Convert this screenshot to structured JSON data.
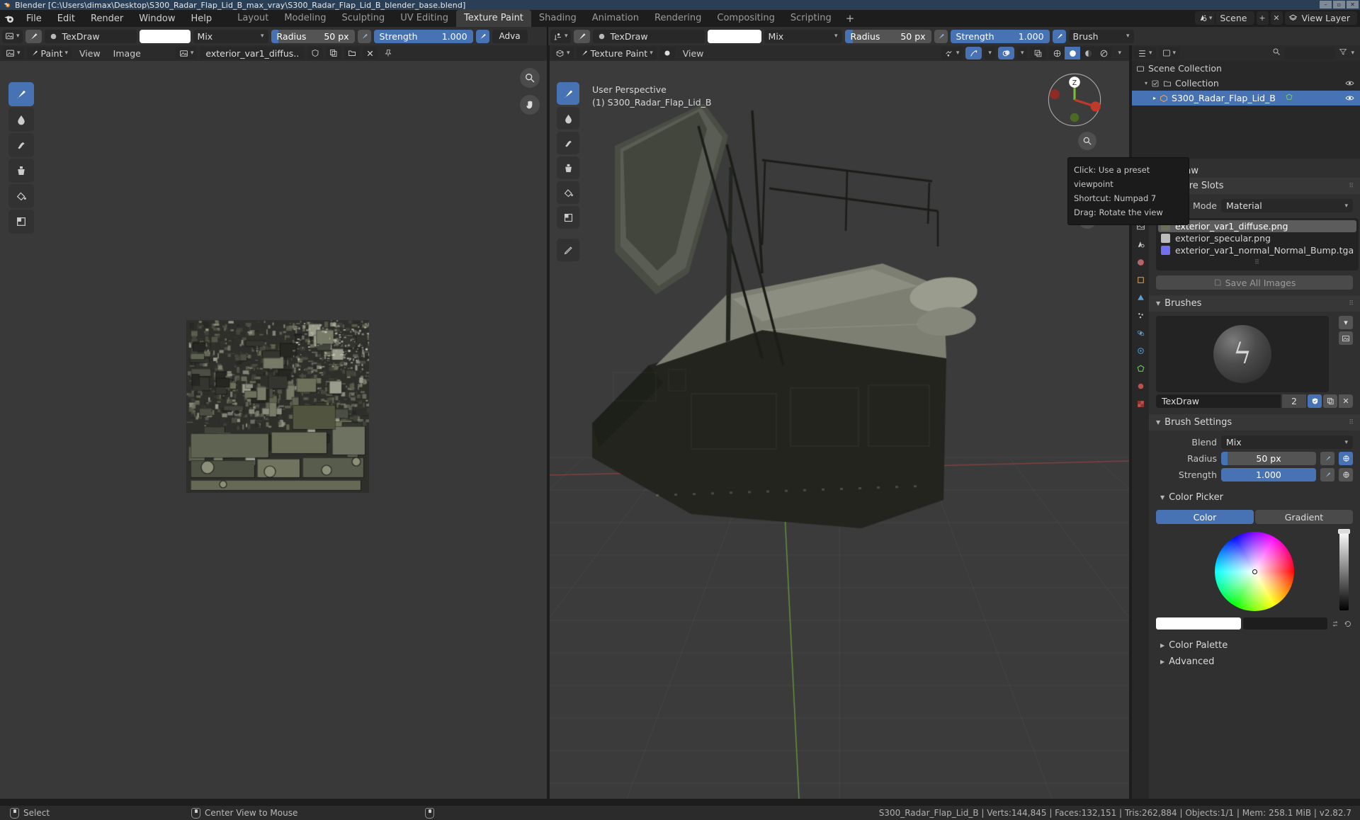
{
  "titlebar": {
    "text": "Blender [C:\\Users\\dimax\\Desktop\\S300_Radar_Flap_Lid_B_max_vray\\S300_Radar_Flap_Lid_B_blender_base.blend]",
    "minimize": "–",
    "maximize": "▫",
    "close": "✕"
  },
  "menu": {
    "items": [
      "File",
      "Edit",
      "Render",
      "Window",
      "Help"
    ]
  },
  "workspace_tabs": [
    {
      "label": "Layout",
      "active": false
    },
    {
      "label": "Modeling",
      "active": false
    },
    {
      "label": "Sculpting",
      "active": false
    },
    {
      "label": "UV Editing",
      "active": false
    },
    {
      "label": "Texture Paint",
      "active": true
    },
    {
      "label": "Shading",
      "active": false
    },
    {
      "label": "Animation",
      "active": false
    },
    {
      "label": "Rendering",
      "active": false
    },
    {
      "label": "Compositing",
      "active": false
    },
    {
      "label": "Scripting",
      "active": false
    }
  ],
  "workspace_add": "+",
  "topright": {
    "scene_name": "Scene",
    "viewlayer_name": "View Layer",
    "new_scene": "+",
    "unlink_scene": "✕",
    "new_layer": "+",
    "remove_layer": "✕"
  },
  "toolsettings_left": {
    "brush_name": "TexDraw",
    "blend": "Mix",
    "radius_label": "Radius",
    "radius_value": "50 px",
    "strength_label": "Strength",
    "strength_value": "1.000",
    "advanced_label": "Adva"
  },
  "toolsettings_right": {
    "brush_name": "TexDraw",
    "blend": "Mix",
    "radius_label": "Radius",
    "radius_value": "50 px",
    "strength_label": "Strength",
    "strength_value": "1.000",
    "brush_label": "Brush"
  },
  "image_editor": {
    "mode": "Paint",
    "menus": [
      "View",
      "Image"
    ],
    "image_name": "exterior_var1_diffus.."
  },
  "viewport": {
    "mode": "Texture Paint",
    "menus": [
      "View"
    ],
    "perspective_label": "User Perspective",
    "object_label": "(1) S300_Radar_Flap_Lid_B",
    "gizmo_axis_z": "Z"
  },
  "tooltip": {
    "line1": "Click: Use a preset viewpoint",
    "line2": "Shortcut: Numpad 7",
    "line3": "Drag: Rotate the view"
  },
  "outliner": {
    "header_label": "Scene Collection",
    "rows": [
      {
        "label": "Scene Collection",
        "indent": 0,
        "selected": false,
        "type": "scene"
      },
      {
        "label": "Collection",
        "indent": 1,
        "selected": false,
        "type": "collection"
      },
      {
        "label": "S300_Radar_Flap_Lid_B",
        "indent": 2,
        "selected": true,
        "type": "object"
      }
    ]
  },
  "properties": {
    "active_tool_header": "Draw",
    "texture_slots": {
      "title": "Texture Slots",
      "mode_label": "Mode",
      "mode_value": "Material",
      "add_button": "+",
      "slots": [
        {
          "name": "exterior_var1_diffuse.png",
          "selected": true,
          "swatch": "#6b6f5a"
        },
        {
          "name": "exterior_specular.png",
          "selected": false,
          "swatch": "#b8b8b8"
        },
        {
          "name": "exterior_var1_normal_Normal_Bump.tga",
          "selected": false,
          "swatch": "#7070f0"
        }
      ],
      "save_all_images": "Save All Images"
    },
    "brushes": {
      "title": "Brushes",
      "brush_name": "TexDraw",
      "users_count": "2",
      "fake_user_icon": "shield-check-icon",
      "duplicate_icon": "copy-icon",
      "delete_icon": "✕"
    },
    "brush_settings": {
      "title": "Brush Settings",
      "blend_label": "Blend",
      "blend_value": "Mix",
      "radius_label": "Radius",
      "radius_value": "50 px",
      "strength_label": "Strength",
      "strength_value": "1.000"
    },
    "color_picker": {
      "title": "Color Picker",
      "tabs": [
        {
          "label": "Color",
          "active": true
        },
        {
          "label": "Gradient",
          "active": false
        }
      ],
      "primary_color": "#ffffff",
      "secondary_color": "#000000"
    },
    "color_palette_title": "Color Palette",
    "advanced_title": "Advanced"
  },
  "statusbar": {
    "left_items": [
      {
        "icon": "mouse-left-icon",
        "label": "Select"
      },
      {
        "icon": "mouse-middle-icon",
        "label": "Center View to Mouse"
      },
      {
        "icon": "mouse-right-icon",
        "label": ""
      }
    ],
    "right_text": "S300_Radar_Flap_Lid_B | Verts:144,845 | Faces:132,151 | Tris:262,884 | Objects:1/1 | Mem: 258.1 MiB | v2.82.7"
  },
  "colors": {
    "accent": "#4772b3",
    "titlebar_bg": "#2a3f55",
    "panel_bg": "#303030",
    "editor_bg": "#393939"
  }
}
